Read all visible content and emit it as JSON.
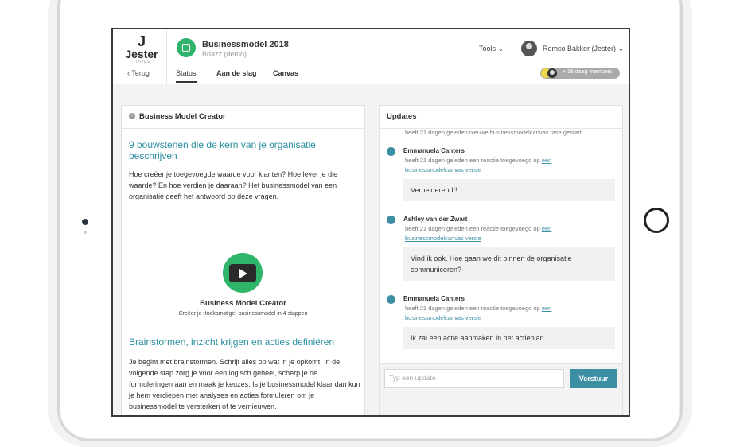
{
  "app": {
    "logo_mark": "J",
    "logo_word": "Jester",
    "logo_sub": "TOOLS",
    "project_title": "Businessmodel 2018",
    "project_subtitle": "Briazz (demo)",
    "tools_label": "Tools ⌄",
    "user_label": "Remco Bakker (Jester) ⌄",
    "members_label": "+ 18 daag members"
  },
  "nav": {
    "back": "‹ Terug",
    "tabs": [
      "Status",
      "Aan de slag",
      "Canvas"
    ],
    "active_tab": "Status"
  },
  "left_panel": {
    "title": "Business Model Creator",
    "heading1": "9 bouwstenen die de kern van je organisatie beschrijven",
    "para1": "Hoe creëer je toegevoegde waarde voor klanten? Hoe lever je die waarde? En hoe verdien je daaraan? Het businessmodel van een organisatie geeft het antwoord op deze vragen.",
    "video_title": "Business Model Creator",
    "video_subtitle": "Creëer je (toekomstige) businessmodel in 4 stappen",
    "heading2": "Brainstormen, inzicht krijgen en acties definiëren",
    "para2": "Je begint met brainstormen. Schrijf alles op wat in je opkomt. In de volgende stap zorg je voor een logisch geheel, scherp je de formuleringen aan en maak je keuzes. Is je businessmodel klaar dan kun je hem verdiepen met analyses en acties formuleren om je businessmodel te versterken of te vernieuwen."
  },
  "right_panel": {
    "title": "Updates",
    "first_line": "heeft 21 dagen geleden nieuwe businessmodelcanvas fase gestart",
    "entries": [
      {
        "name": "Emmanuela Canters",
        "text": "heeft 21 dagen geleden een reactie toegevoegd op",
        "link1": "een",
        "link2": "businessmodelcanvas versie",
        "comment": "Verhelderend!!"
      },
      {
        "name": "Ashley van der Zwart",
        "text": "heeft 21 dagen geleden een reactie toegevoegd op",
        "link1": "een",
        "link2": "businessmodelcanvas versie",
        "comment": "Vind ik ook. Hoe gaan we dit binnen de organisatie communiceren?"
      },
      {
        "name": "Emmanuela Canters",
        "text": "heeft 21 dagen geleden een reactie toegevoegd op",
        "link1": "een",
        "link2": "businessmodelcanvas versie",
        "comment": "Ik zal een actie aanmaken in het actieplan"
      }
    ],
    "input_placeholder": "Typ een update",
    "send_label": "Verstuur"
  },
  "colors": {
    "accent": "#3c8ea3",
    "brand_green": "#2fb56a",
    "heading": "#2a8fa0"
  }
}
